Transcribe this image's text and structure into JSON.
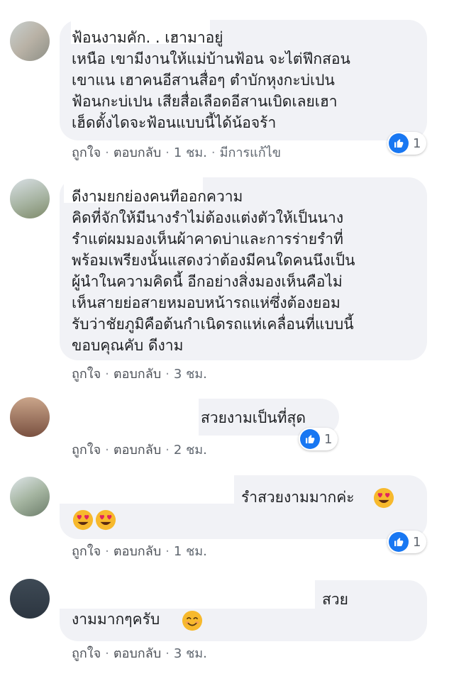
{
  "actions": {
    "like": "ถูกใจ",
    "reply": "ตอบกลับ",
    "separator": "·"
  },
  "comments": [
    {
      "text": "ฟ้อนงามคัก. . เฮามาอยู่\nเหนือ เขามีงานให้แม่บ้านฟ้อน จะไต่ฟึกสอน\nเขาแน เฮาคนอีสานสื่อๆ ตำบักหุงกะบ่เปน\nฟ้อนกะบ่เปน เสียสื่อเลือดอีสานเบิดเลยเฮา\nเฮ็ดตั้งไดจะฟ้อนแบบนี้ได้น้อจร้า",
      "time": "1 ชม.",
      "edited": "มีการแก้ไข",
      "reaction_count": "1"
    },
    {
      "text": "ดีงามยกย่องคนทีออกความ\nคิดที่จักให้มีนางรำไม่ต้องแต่งตัวให้เป็นนาง\nรำแต่ผมมองเห็นผ้าคาดบ่าและการร่ายรำที่\nพร้อมเพรียงนั้นแสดงว่าต้องมีคนใดคนนึงเป็น\nผู้นำในความคิดนี้ อีกอย่างสิ่งมองเห็นคือไม่\nเห็นสายย่อสายหมอบหน้ารถแห่ซึ่งต้องยอม\nรับว่าชัยภูมิคือต้นกำเนิดรถแห่เคลื่อนที่แบบนี้\nขอบคุณคับ ดีงาม",
      "time": "3 ชม."
    },
    {
      "text": "สวยงามเป็นที่สุด",
      "time": "2 ชม.",
      "reaction_count": "1"
    },
    {
      "text": "รำสวยงามมากค่ะ",
      "time": "1 ชม.",
      "reaction_count": "1",
      "emojis": [
        "heart-eyes-emoji",
        "heart-eyes-emoji",
        "heart-eyes-emoji"
      ]
    },
    {
      "text_line1": "สวย",
      "text_line2": "งามมากๆครับ",
      "time": "3 ชม.",
      "emojis": [
        "smiling-face-emoji"
      ]
    }
  ],
  "colors": {
    "bubble": "#f1f2f6",
    "like_blue": "#1877f2",
    "meta_text": "#606770",
    "emoji_yellow": "#f7b92d",
    "heart_red": "#e0245e"
  }
}
